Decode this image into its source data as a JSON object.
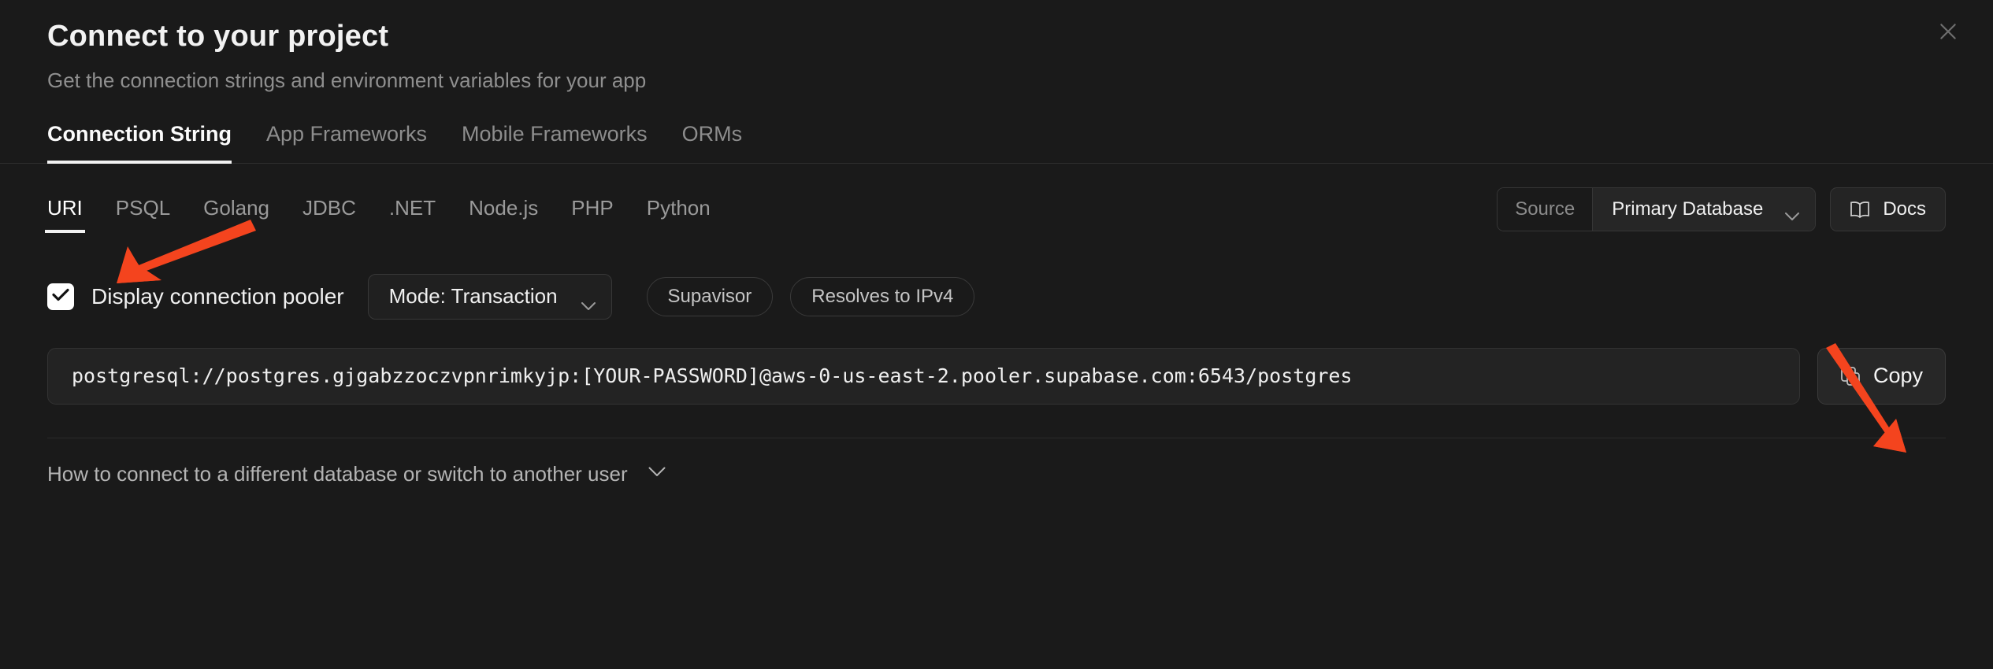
{
  "dialog": {
    "title": "Connect to your project",
    "subtitle": "Get the connection strings and environment variables for your app",
    "close_icon": "close-icon"
  },
  "tabs": [
    {
      "label": "Connection String",
      "active": true
    },
    {
      "label": "App Frameworks",
      "active": false
    },
    {
      "label": "Mobile Frameworks",
      "active": false
    },
    {
      "label": "ORMs",
      "active": false
    }
  ],
  "subtabs": [
    {
      "label": "URI",
      "active": true
    },
    {
      "label": "PSQL",
      "active": false
    },
    {
      "label": "Golang",
      "active": false
    },
    {
      "label": "JDBC",
      "active": false
    },
    {
      "label": ".NET",
      "active": false
    },
    {
      "label": "Node.js",
      "active": false
    },
    {
      "label": "PHP",
      "active": false
    },
    {
      "label": "Python",
      "active": false
    }
  ],
  "source": {
    "label": "Source",
    "value": "Primary Database",
    "chevron_icon": "chevron-down-icon"
  },
  "docs": {
    "label": "Docs",
    "icon": "book-icon"
  },
  "pooler": {
    "checkbox_icon": "check-icon",
    "checked": true,
    "label": "Display connection pooler",
    "mode_label": "Mode: Transaction",
    "mode_chevron_icon": "chevron-down-icon",
    "badges": [
      "Supavisor",
      "Resolves to IPv4"
    ]
  },
  "connection": {
    "string": "postgresql://postgres.gjgabzzoczvpnrimkyjp:[YOUR-PASSWORD]@aws-0-us-east-2.pooler.supabase.com:6543/postgres",
    "copy_label": "Copy",
    "copy_icon": "copy-icon"
  },
  "footer": {
    "link": "How to connect to a different database or switch to another user",
    "chevron_icon": "chevron-down-icon"
  },
  "annotations": {
    "accent_color": "#F4441E",
    "arrows": [
      {
        "name": "arrow-to-uri-tab",
        "target": "URI"
      },
      {
        "name": "arrow-to-copy-button",
        "target": "Copy"
      }
    ]
  }
}
